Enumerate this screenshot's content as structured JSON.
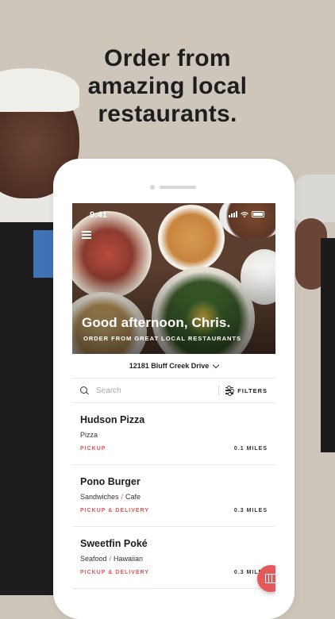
{
  "marketing": {
    "headline_lines": [
      "Order from",
      "amazing local",
      "restaurants."
    ]
  },
  "status_bar": {
    "time": "9:41"
  },
  "hero": {
    "greeting": "Good afternoon, Chris.",
    "subtitle": "ORDER FROM GREAT LOCAL RESTAURANTS"
  },
  "address": {
    "value": "12181 Bluff Creek Drive"
  },
  "search": {
    "placeholder": "Search",
    "filters_label": "FILTERS"
  },
  "restaurants": [
    {
      "name": "Hudson Pizza",
      "categories": [
        "Pizza"
      ],
      "mode": "PICKUP",
      "distance": "0.1 MILES"
    },
    {
      "name": "Pono Burger",
      "categories": [
        "Sandwiches",
        "Cafe"
      ],
      "mode": "PICKUP & DELIVERY",
      "distance": "0.3 MILES"
    },
    {
      "name": "Sweetfin Poké",
      "categories": [
        "Seafood",
        "Hawaiian"
      ],
      "mode": "PICKUP & DELIVERY",
      "distance": "0.3 MILES"
    }
  ],
  "category_separator": "/",
  "colors": {
    "accent": "#e5595a",
    "background": "#cfc6bb",
    "text": "#1e1e1e"
  },
  "icons": {
    "menu": "hamburger-menu-icon",
    "search": "search-icon",
    "filters": "sliders-icon",
    "map": "map-icon",
    "address": "chevron-down-icon"
  }
}
